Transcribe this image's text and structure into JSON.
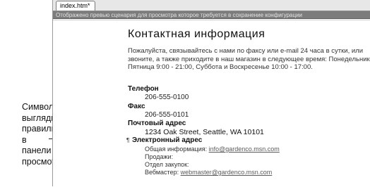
{
  "annotation": {
    "lines": [
      "Символ",
      "выглядит",
      "правильно в",
      "панели",
      "просмотра"
    ]
  },
  "tab": {
    "label": "index.htm*"
  },
  "infobar": {
    "text": "Отображено превью сценария для просмотра которое требуется в сохранение конфигурации"
  },
  "page": {
    "title": "Контактная информация",
    "intro": [
      "Пожалуйста, связывайтесь с нами по факсу или e-mail 24 часа в сутки, или",
      "звоните, а также приходите в наш магазин в следующее время: Понедельник -",
      "Пятница 9:00 - 21:00, Суббота и Воскресенье 10:00 - 17:00."
    ],
    "phone_label": "Телефон",
    "phone_value": "206-555-0100",
    "fax_label": "Факс",
    "fax_value": "206-555-0101",
    "postal_label": "Почтовый адрес",
    "postal_value": "1234 Oak Street, Seattle, WA 10101",
    "email_mark": "¶",
    "email_label": "Электронный адрес",
    "general_label": "Общая информация:",
    "general_link": "info@gardenco.msn.com",
    "sales_label": "Продажи:",
    "purchasing_label": "Отдел закупок:",
    "webmaster_label": "Вебмастер:",
    "webmaster_link": "webmaster@gardenco.msn.com"
  }
}
